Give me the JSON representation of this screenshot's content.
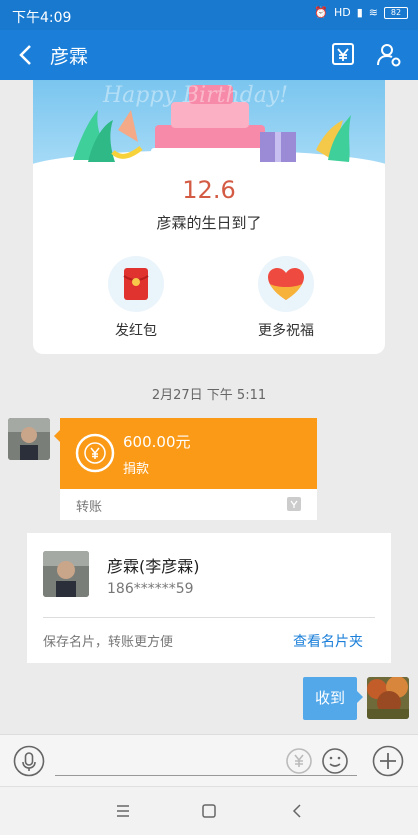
{
  "status_bar": {
    "time": "下午4:09",
    "signal": "HD",
    "battery": "82"
  },
  "nav": {
    "title": "彦霖"
  },
  "birthday_card": {
    "date": "12.6",
    "message": "彦霖的生日到了",
    "actions": [
      {
        "label": "发红包",
        "icon": "red-envelope-icon"
      },
      {
        "label": "更多祝福",
        "icon": "heart-icon"
      }
    ]
  },
  "timestamp": "2月27日 下午 5:11",
  "transfer": {
    "amount": "600.00元",
    "subtitle": "捐款",
    "footer": "转账"
  },
  "contact_card": {
    "name": "彦霖(李彦霖)",
    "phone": "186******59",
    "hint": "保存名片，转账更方便",
    "action": "查看名片夹"
  },
  "sent_message": "收到",
  "input": {
    "placeholder": ""
  },
  "colors": {
    "accent": "#1b7fd9",
    "transfer": "#fb9a16",
    "bubble": "#53a8ea",
    "date": "#d45b43"
  }
}
